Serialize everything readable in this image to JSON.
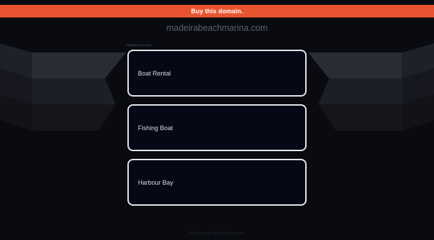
{
  "banner": {
    "label": "Buy this domain."
  },
  "domain": {
    "name": "madeirabeachmarina.com"
  },
  "related": {
    "heading": "Related searches",
    "items": [
      {
        "label": "Boat Rental"
      },
      {
        "label": "Fishing Boat"
      },
      {
        "label": "Harbour Bay"
      }
    ]
  },
  "footer": {
    "text": "2025 Copyright. All Rights Reserved."
  },
  "colors": {
    "accent": "#e8542f",
    "background": "#0a0b10",
    "card": "#060915",
    "card_border": "#e8e9ee"
  }
}
